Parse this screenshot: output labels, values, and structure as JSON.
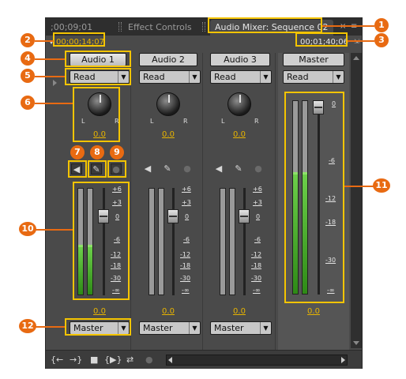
{
  "tabs": {
    "left_timecode": ";00;09;01",
    "effect_controls": "Effect Controls",
    "audio_mixer": "Audio Mixer: Sequence 02"
  },
  "timecodes": {
    "current": "00;00;14;07",
    "duration": "00;01;40;06"
  },
  "channels": [
    {
      "name": "Audio 1",
      "mode": "Read",
      "pan_value": "0.0",
      "vol_value": "0.0",
      "output": "Master"
    },
    {
      "name": "Audio 2",
      "mode": "Read",
      "pan_value": "0.0",
      "vol_value": "0.0",
      "output": "Master"
    },
    {
      "name": "Audio 3",
      "mode": "Read",
      "pan_value": "0.0",
      "vol_value": "0.0",
      "output": "Master"
    }
  ],
  "master": {
    "name": "Master",
    "mode": "Read",
    "vol_value": "0.0"
  },
  "knob_labels": {
    "left": "L",
    "right": "R"
  },
  "track_scale": [
    "+6",
    "+3",
    "0",
    "-6",
    "-12",
    "-18",
    "-30",
    "-∞"
  ],
  "master_scale": [
    "0",
    "-6",
    "-12",
    "-18",
    "-30",
    "-∞"
  ],
  "icons": {
    "mute": "speaker-icon",
    "solo": "headphone-icon",
    "record": "microphone-icon"
  },
  "levels": {
    "audio1_meter": 0.45,
    "master_meter": 0.62
  },
  "callouts": [
    "1",
    "2",
    "3",
    "4",
    "5",
    "6",
    "7",
    "8",
    "9",
    "10",
    "11",
    "12"
  ],
  "colors": {
    "highlight": "#f4c400",
    "callout": "#e86a12",
    "meter": "#3aa61e"
  }
}
